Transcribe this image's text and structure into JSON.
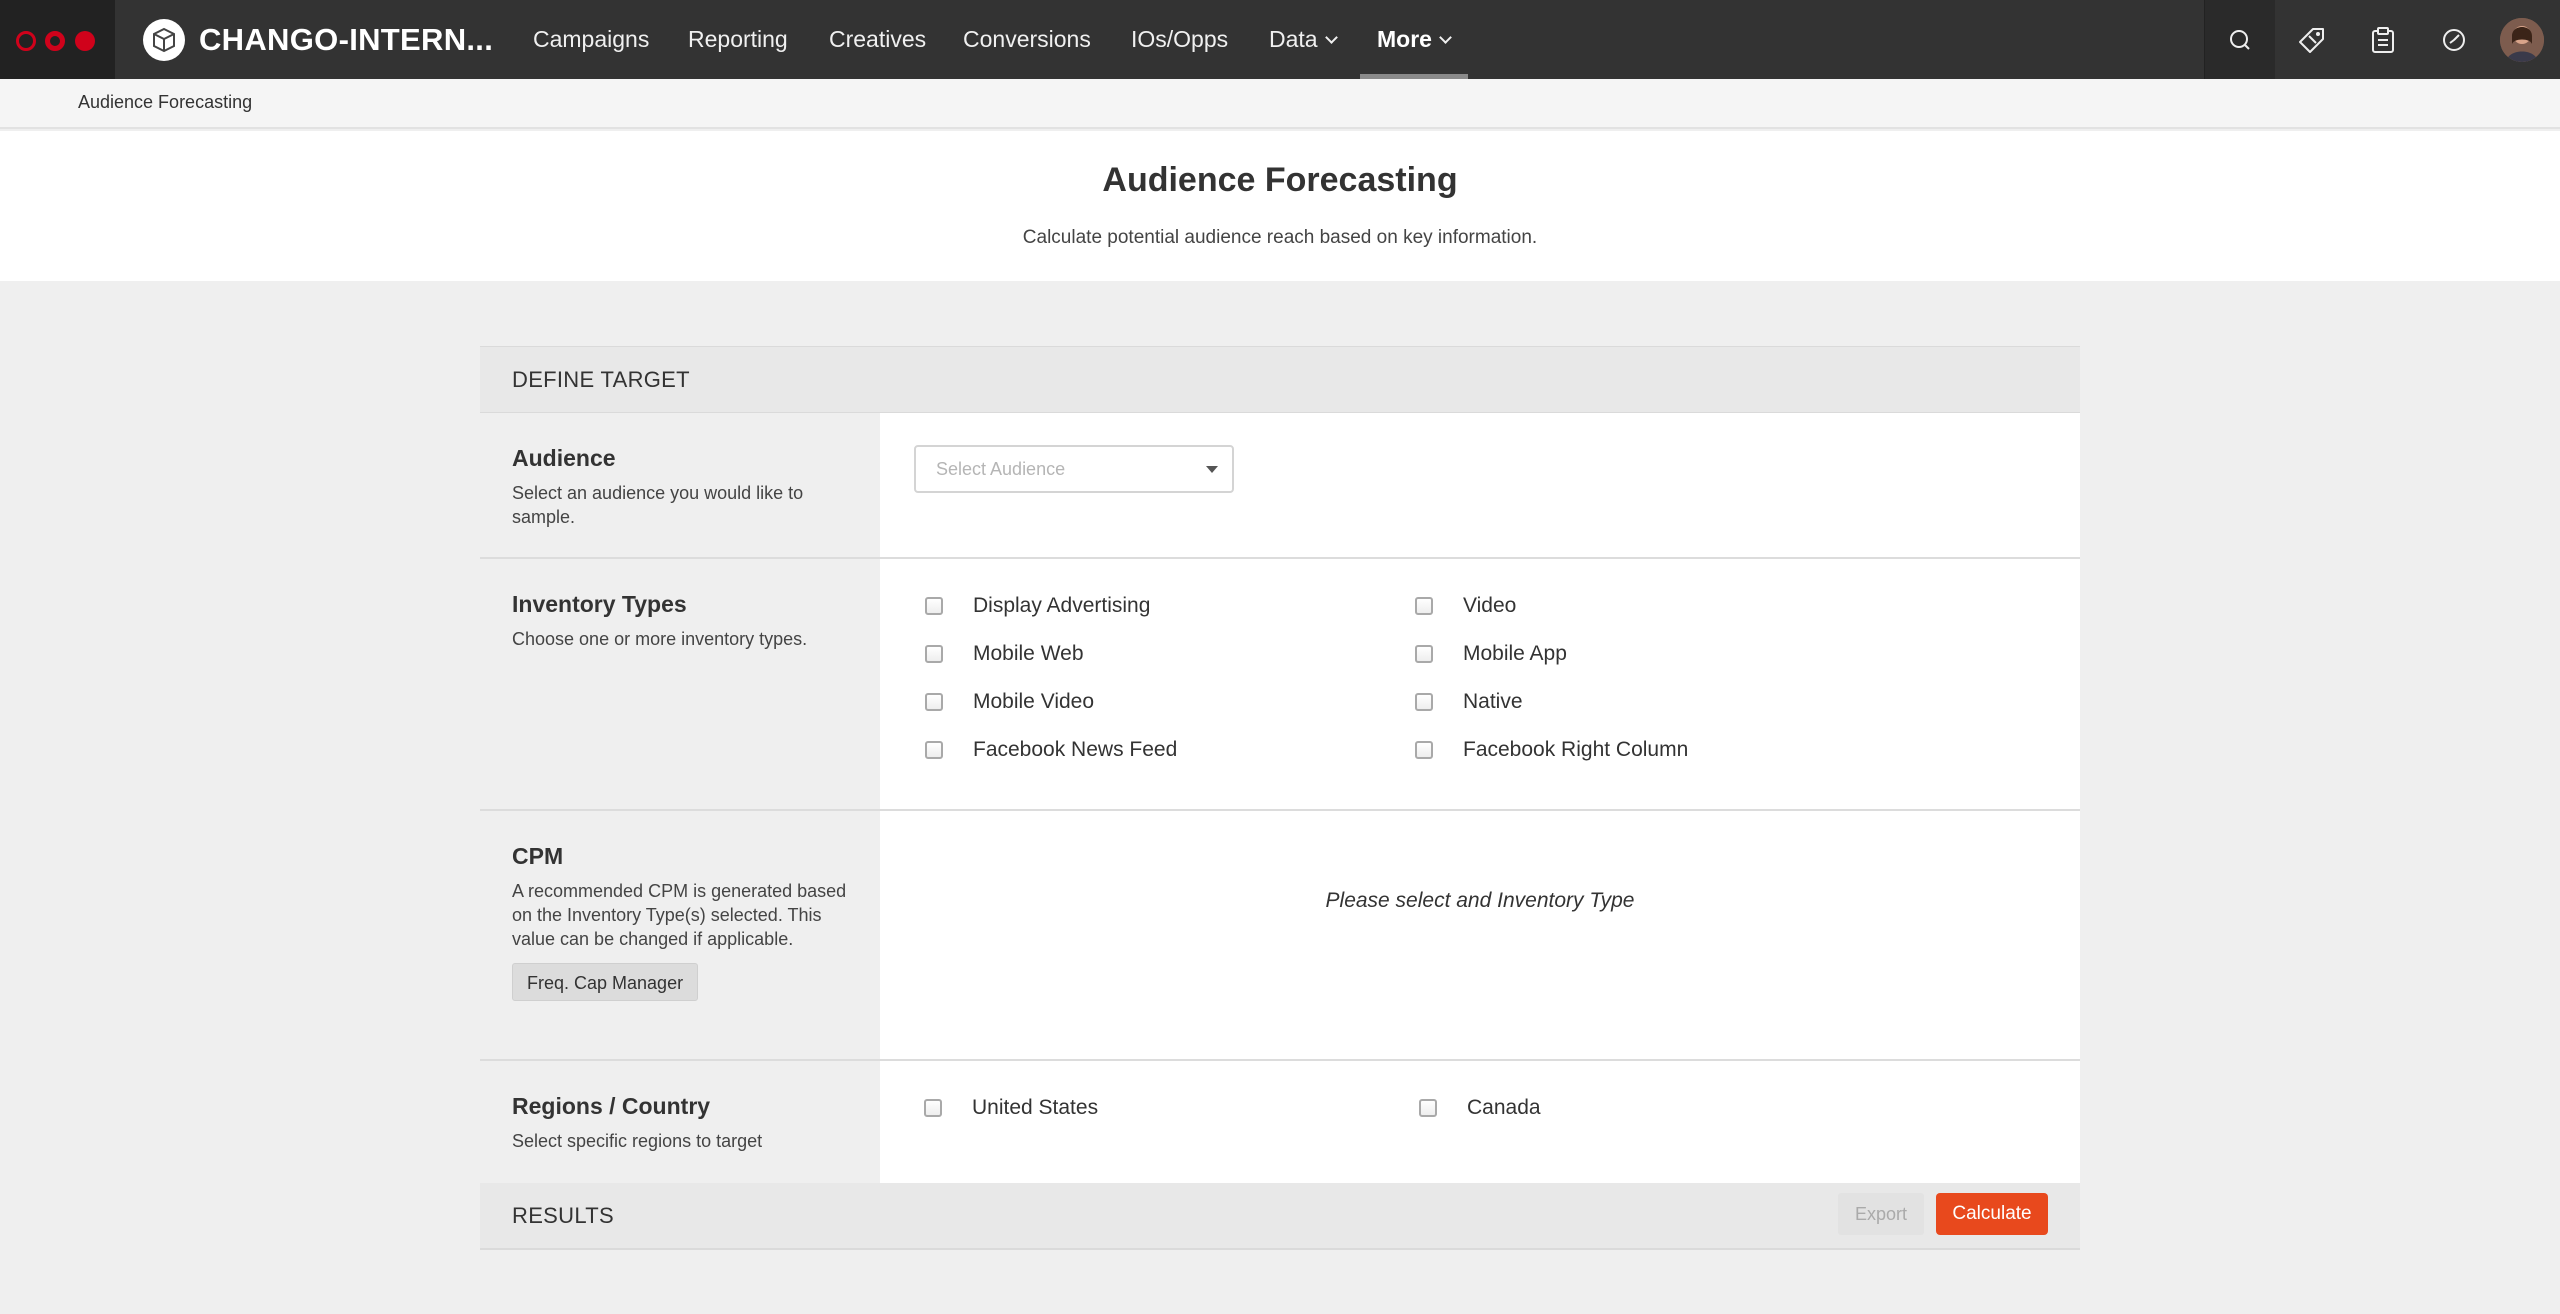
{
  "app": {
    "brand": "CHANGO-INTERN...",
    "logo_icon": "cube-icon",
    "accent_color": "#e8491d",
    "brand_color": "#d0021b"
  },
  "nav": {
    "items": [
      {
        "label": "Campaigns"
      },
      {
        "label": "Reporting"
      },
      {
        "label": "Creatives"
      },
      {
        "label": "Conversions"
      },
      {
        "label": "IOs/Opps"
      },
      {
        "label": "Data",
        "dropdown": true
      },
      {
        "label": "More",
        "dropdown": true,
        "active": true
      }
    ],
    "tools": [
      "search-icon",
      "tag-icon",
      "clipboard-icon",
      "clock-icon",
      "avatar"
    ]
  },
  "breadcrumb": "Audience Forecasting",
  "header": {
    "title": "Audience Forecasting",
    "subtitle": "Calculate potential audience reach based on key information."
  },
  "define_target": {
    "heading": "DEFINE TARGET",
    "audience": {
      "title": "Audience",
      "description": "Select an audience you would like to sample.",
      "placeholder": "Select Audience"
    },
    "inventory": {
      "title": "Inventory Types",
      "description": "Choose one or more inventory types.",
      "options": [
        {
          "label": "Display Advertising",
          "checked": false
        },
        {
          "label": "Video",
          "checked": false
        },
        {
          "label": "Mobile Web",
          "checked": false
        },
        {
          "label": "Mobile App",
          "checked": false
        },
        {
          "label": "Mobile Video",
          "checked": false
        },
        {
          "label": "Native",
          "checked": false
        },
        {
          "label": "Facebook News Feed",
          "checked": false
        },
        {
          "label": "Facebook Right Column",
          "checked": false
        }
      ]
    },
    "cpm": {
      "title": "CPM",
      "description": "A recommended CPM is generated based on the Inventory Type(s) selected. This value can be changed if applicable.",
      "freq_button": "Freq. Cap Manager",
      "message": "Please select and Inventory Type"
    },
    "regions": {
      "title": "Regions / Country",
      "description": "Select specific regions to target",
      "options": [
        {
          "label": "United States",
          "checked": false
        },
        {
          "label": "Canada",
          "checked": false
        }
      ]
    }
  },
  "results": {
    "heading": "RESULTS",
    "export_label": "Export",
    "calculate_label": "Calculate"
  }
}
